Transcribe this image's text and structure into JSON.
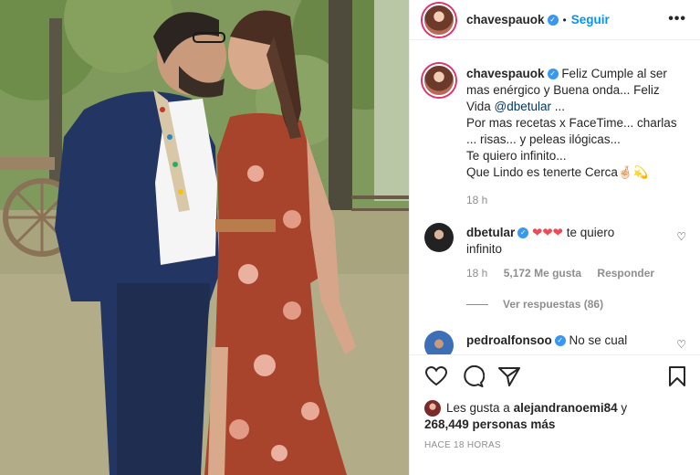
{
  "post": {
    "username": "chavespauok",
    "follow_label": "Seguir",
    "more_label": "•••",
    "verified_mark": "✓"
  },
  "caption": {
    "username": "chavespauok",
    "line1": "Feliz Cumple al ser",
    "line2": "mas enérgico y Buena onda... Feliz",
    "line3_prefix": "Vida ",
    "mention": "@dbetular",
    "line3_suffix": " ...",
    "line4": "Por mas recetas x FaceTime... charlas",
    "line5": "... risas... y peleas ilógicas...",
    "line6": "Te quiero infinito...",
    "line7": "Que Lindo es tenerte Cerca🤞🏻💫",
    "time": "18 h"
  },
  "comments": [
    {
      "username": "dbetular",
      "hearts": "❤❤❤",
      "text": " te quiero",
      "text2": "infinito",
      "time": "18 h",
      "likes": "5,172 Me gusta",
      "reply": "Responder",
      "view_replies": "Ver respuestas (86)"
    },
    {
      "username": "pedroalfonsoo",
      "text": "No se cual"
    }
  ],
  "actions": {
    "like_icon": "heart-outline",
    "comment_icon": "speech-bubble",
    "share_icon": "paper-plane",
    "save_icon": "bookmark"
  },
  "likes": {
    "prefix": "Les gusta a ",
    "user": "alejandranoemi84",
    "joiner": " y",
    "count": "268,449 personas más"
  },
  "timestamp": "HACE 18 HORAS",
  "colors": {
    "accent": "#0095f6",
    "verified": "#3897f0",
    "heart_red": "#ed4956"
  }
}
